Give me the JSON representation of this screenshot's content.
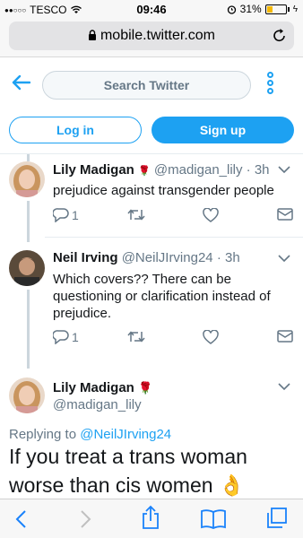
{
  "status_bar": {
    "signal": "●●○○○",
    "carrier": "TESCO",
    "time": "09:46",
    "battery_percent": "31%",
    "battery_level": 0.31
  },
  "browser": {
    "url": "mobile.twitter.com"
  },
  "nav": {
    "search_placeholder": "Search Twitter"
  },
  "auth": {
    "login_label": "Log in",
    "signup_label": "Sign up"
  },
  "tweets": [
    {
      "name": "Lily Madigan",
      "emoji": "🌹",
      "handle": "@madigan_lily",
      "sep": "·",
      "time": "3h",
      "text": "prejudice against transgender people",
      "reply_count": "1",
      "retweet_count": "",
      "like_count": ""
    },
    {
      "name": "Neil Irving",
      "handle": "@NeilJIrving24",
      "sep": "·",
      "time": "3h",
      "text": "Which covers?? There can be questioning or clarification instead of prejudice.",
      "reply_count": "1",
      "retweet_count": "",
      "like_count": ""
    }
  ],
  "main_tweet": {
    "name": "Lily Madigan",
    "emoji": "🌹",
    "handle": "@madigan_lily",
    "replying_label": "Replying to",
    "replying_to": "@NeilJIrving24",
    "text": "If you treat a trans woman worse than cis women",
    "text_emoji": "👌"
  },
  "colors": {
    "accent": "#1da1f2",
    "muted": "#657786",
    "text": "#14171a",
    "divider": "#e6ecf0"
  },
  "icons": {
    "back": "arrow-left-icon",
    "more": "vertical-dots-icon",
    "reply": "reply-icon",
    "retweet": "retweet-icon",
    "like": "heart-icon",
    "dm": "envelope-icon",
    "chevron": "chevron-down-icon"
  }
}
